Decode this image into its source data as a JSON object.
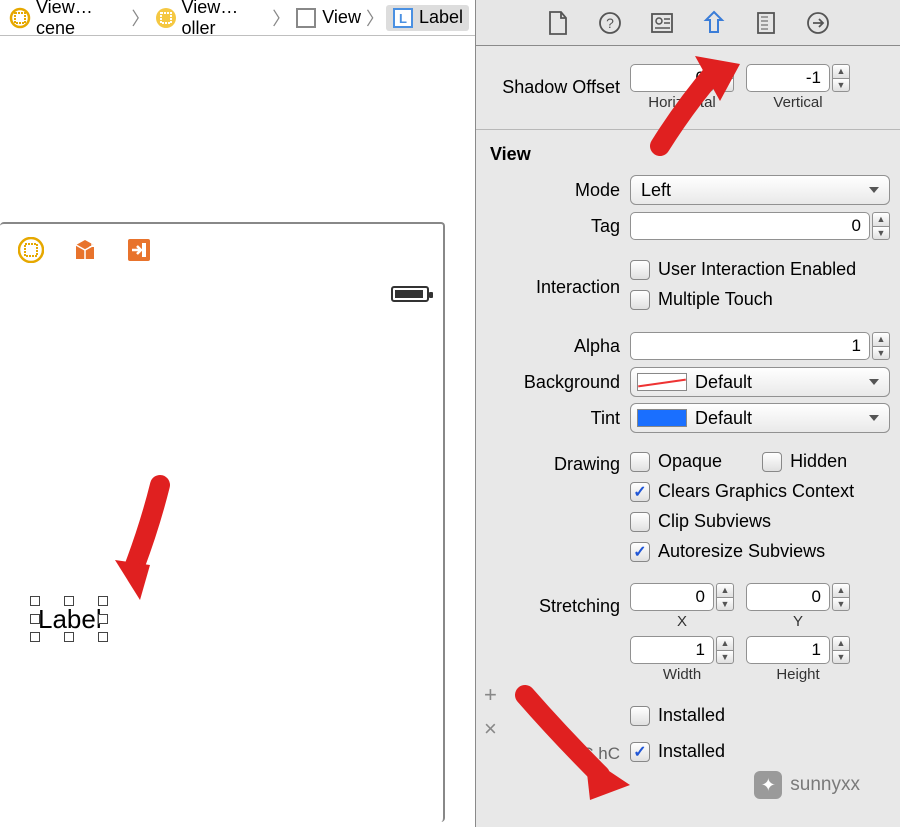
{
  "breadcrumb": {
    "item0": "View…cene",
    "item1": "View…oller",
    "item2": "View",
    "item3": "Label"
  },
  "canvas": {
    "label_text": "Label"
  },
  "inspector_tabs": [
    "file",
    "quick-help",
    "identity",
    "attributes",
    "size",
    "connections"
  ],
  "shadow": {
    "label": "Shadow Offset",
    "horizontal_value": "0",
    "horizontal_caption": "Horizontal",
    "vertical_value": "-1",
    "vertical_caption": "Vertical"
  },
  "view": {
    "section_title": "View",
    "mode_label": "Mode",
    "mode_value": "Left",
    "tag_label": "Tag",
    "tag_value": "0",
    "interaction_label": "Interaction",
    "user_interaction": "User Interaction Enabled",
    "multiple_touch": "Multiple Touch",
    "alpha_label": "Alpha",
    "alpha_value": "1",
    "background_label": "Background",
    "background_value": "Default",
    "tint_label": "Tint",
    "tint_value": "Default",
    "drawing": {
      "label": "Drawing",
      "opaque": "Opaque",
      "hidden": "Hidden",
      "clears": "Clears Graphics Context",
      "clip": "Clip Subviews",
      "autoresize": "Autoresize Subviews"
    },
    "stretching": {
      "label": "Stretching",
      "x_value": "0",
      "x_caption": "X",
      "y_value": "0",
      "y_caption": "Y",
      "w_value": "1",
      "w_caption": "Width",
      "h_value": "1",
      "h_caption": "Height"
    },
    "installed": {
      "label_any": "Installed",
      "label_sc": "Installed",
      "size_class": "wC hC"
    }
  },
  "watermark": "sunnyxx"
}
